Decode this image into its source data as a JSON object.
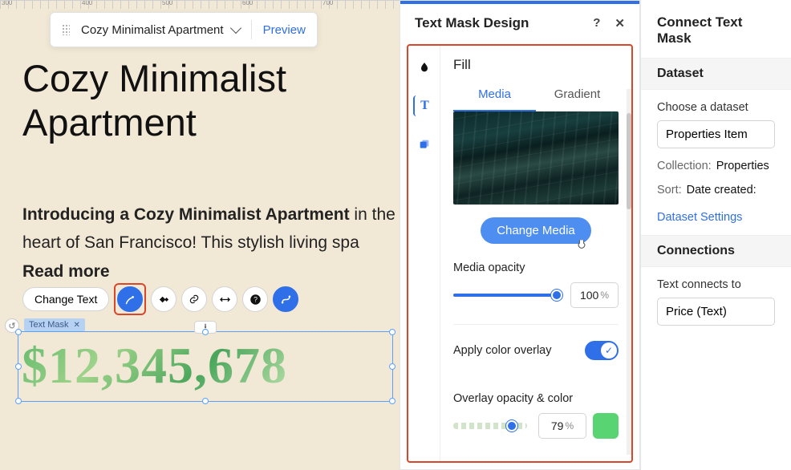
{
  "page_toolbar": {
    "page_name": "Cozy Minimalist Apartment",
    "preview_label": "Preview"
  },
  "ruler_marks": [
    "300",
    "400",
    "500",
    "600",
    "700"
  ],
  "content": {
    "headline_line1": "Cozy Minimalist",
    "headline_line2": "Apartment",
    "body_bold": "Introducing a Cozy Minimalist Apartment",
    "body_rest": " in the heart of San Francisco! This stylish living spa",
    "read_more": "Read more",
    "price": "$12,345,678"
  },
  "element_toolbar": {
    "change_text": "Change Text"
  },
  "element_tag": "Text Mask",
  "design_panel": {
    "title": "Text Mask Design",
    "section_fill": "Fill",
    "tab_media": "Media",
    "tab_gradient": "Gradient",
    "change_media": "Change Media",
    "media_opacity_label": "Media opacity",
    "media_opacity_value": "100",
    "apply_overlay_label": "Apply color overlay",
    "overlay_label": "Overlay opacity & color",
    "overlay_value": "79",
    "unit": "%"
  },
  "right_panel": {
    "title": "Connect Text Mask",
    "dataset_head": "Dataset",
    "choose_label": "Choose a dataset",
    "dataset_value": "Properties Item",
    "collection_k": "Collection:",
    "collection_v": "Properties",
    "sort_k": "Sort:",
    "sort_v": "Date created:",
    "settings_link": "Dataset Settings",
    "connections_head": "Connections",
    "text_connects_label": "Text connects to",
    "text_connects_value": "Price (Text)"
  }
}
